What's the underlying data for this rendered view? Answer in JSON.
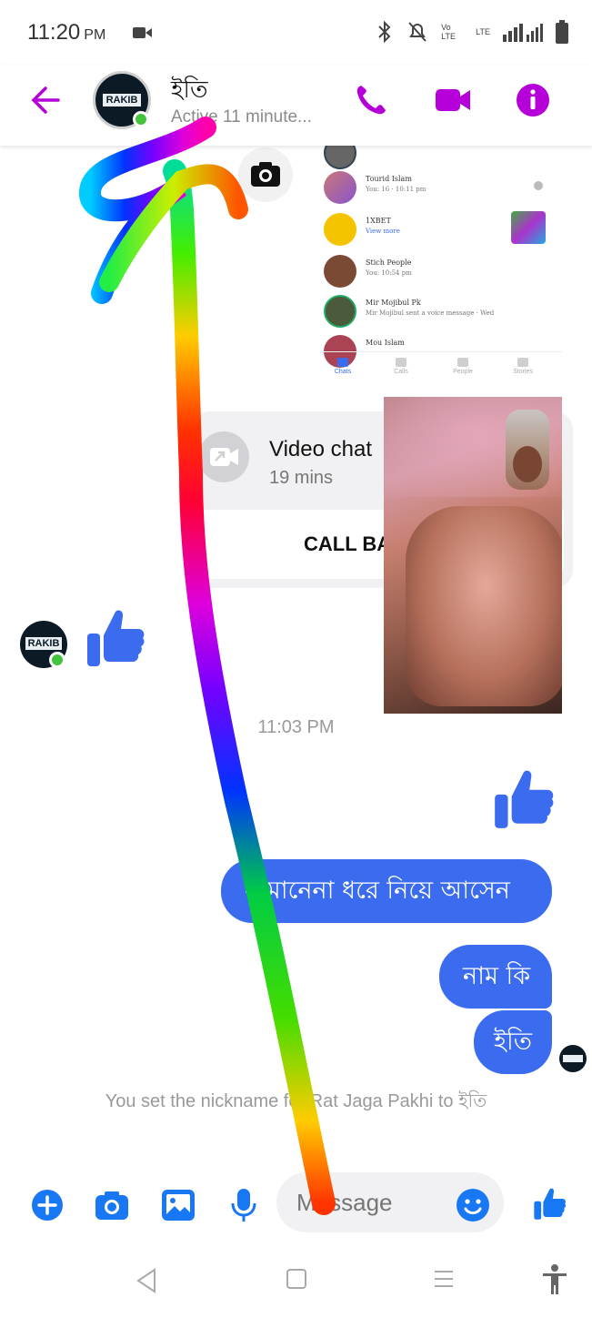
{
  "status_bar": {
    "time": "11:20",
    "ampm": "PM",
    "network_1": "Vo LTE",
    "network_2": "LTE"
  },
  "header": {
    "contact_name": "ইতি",
    "contact_status": "Active 11 minute...",
    "avatar_text": "RAKIB",
    "colors": {
      "accent": "#b600d9"
    }
  },
  "shared_screenshot": {
    "rows": [
      {
        "name": "Tourid Islam",
        "message": "You: 16 · 10:11 pm"
      },
      {
        "name": "1XBET",
        "message": "Ads",
        "badge": "View more"
      },
      {
        "name": "Stich People",
        "message": "You: 10:54 pm"
      },
      {
        "name": "Mir Mojibul Pk",
        "message": "Mir Mojibul sent a voice message · Wed"
      },
      {
        "name": "Mou Islam",
        "message": ""
      }
    ],
    "tabs": [
      "Chats",
      "Calls",
      "People",
      "Stories"
    ]
  },
  "call_card": {
    "title": "Video chat",
    "time": "19 mins",
    "call_back_label": "CALL BACK"
  },
  "timestamp": "11:03 PM",
  "messages": [
    {
      "text": "ন মানেনা ধরে নিয়ে আসেন"
    },
    {
      "text": "নাম কি"
    },
    {
      "text": "ইতি"
    }
  ],
  "system_message": "You set the nickname for Rat Jaga Pakhi to ইতি",
  "composer": {
    "placeholder": "Message"
  },
  "colors": {
    "bubble": "#3b6cf0",
    "like": "#3b6cf0",
    "composer_icons": "#1877f2",
    "online": "#44c33c"
  }
}
